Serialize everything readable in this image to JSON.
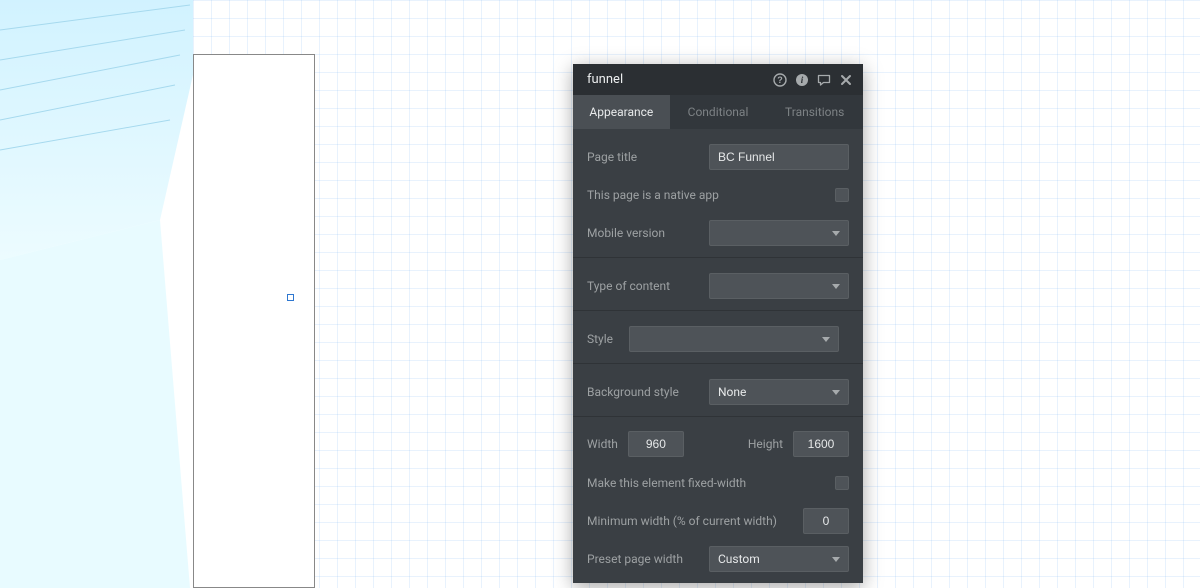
{
  "panel": {
    "title": "funnel",
    "tabs": {
      "appearance": "Appearance",
      "conditional": "Conditional",
      "transitions": "Transitions"
    },
    "labels": {
      "page_title": "Page title",
      "native_app": "This page is a native app",
      "mobile_version": "Mobile version",
      "type_of_content": "Type of content",
      "style": "Style",
      "background_style": "Background style",
      "width": "Width",
      "height": "Height",
      "fixed_width": "Make this element fixed-width",
      "min_width": "Minimum width (% of current width)",
      "preset_page_width": "Preset page width"
    },
    "values": {
      "page_title": "BC Funnel",
      "mobile_version": "",
      "type_of_content": "",
      "style": "",
      "background_style": "None",
      "width": "960",
      "height": "1600",
      "min_width": "0",
      "preset_page_width": "Custom"
    }
  }
}
